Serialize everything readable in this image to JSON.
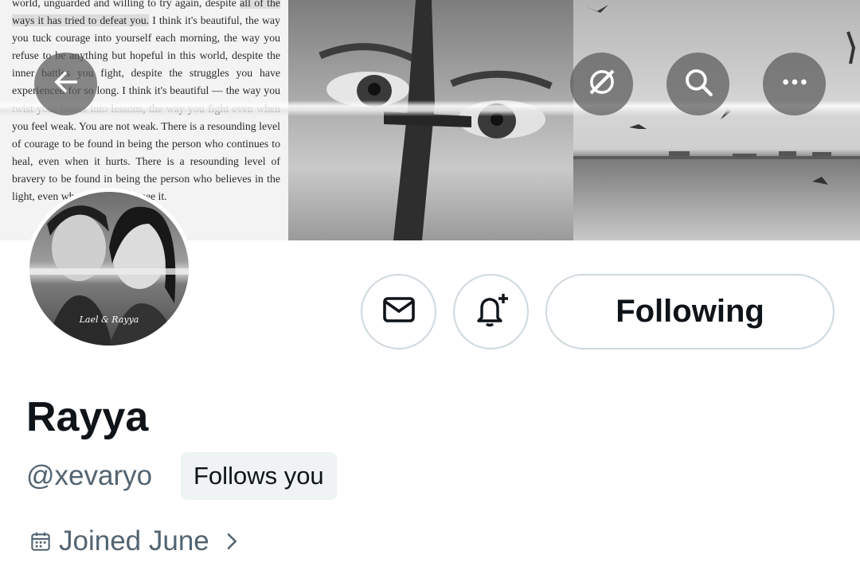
{
  "banner": {
    "quote_line_1": "world, unguarded and willing to try again, despite",
    "quote_line_2_highlight": "all of the ways it has tried to defeat you.",
    "quote_line_2_rest": " I think it's",
    "quote_rest": "beautiful, the way you tuck courage into yourself each morning, the way you refuse to be anything but hopeful in this world, despite the inner battles you fight, despite the struggles you have experienced for so long. I think it's beautiful — the way you twist your losses into lessons, the way you fight even when you feel weak. You are not weak. There is a resounding level of courage to be found in being the person who continues to heal, even when it hurts. There is a resounding level of bravery to be found in being the person who believes in the light, even when they cannot see it."
  },
  "avatar": {
    "caption": "Lael & Rayya"
  },
  "actions": {
    "following_label": "Following"
  },
  "profile": {
    "display_name": "Rayya",
    "handle": "@xevaryo",
    "follows_you": "Follows you",
    "joined": "Joined June"
  },
  "icons": {
    "back": "arrow-left-icon",
    "grok": "grok-icon",
    "search": "search-icon",
    "more": "more-icon",
    "message": "envelope-icon",
    "notify": "bell-plus-icon",
    "calendar": "calendar-icon",
    "chevron": "chevron-right-icon"
  },
  "colors": {
    "text_primary": "#0f1419",
    "text_secondary": "#536471",
    "border": "#cfd9de",
    "badge_bg": "#eff3f4"
  }
}
